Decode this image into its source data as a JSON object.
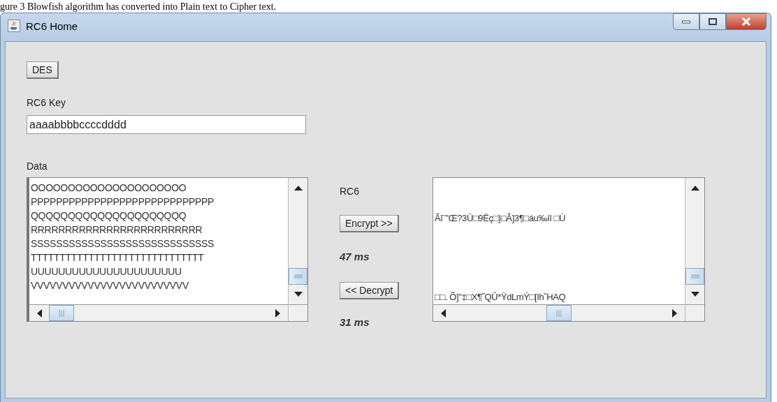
{
  "caption": "gure 3 Blowfish algorithm has converted into Plain text to Cipher text.",
  "window": {
    "title": "RC6 Home"
  },
  "des_button": "DES",
  "key": {
    "label": "RC6 Key",
    "value": "aaaabbbbccccdddd"
  },
  "data": {
    "label": "Data",
    "lines": [
      "OOOOOOOOOOOOOOOOOOOOO",
      "PPPPPPPPPPPPPPPPPPPPPPPPPPPPP",
      "QQQQQQQQQQQQQQQQQQQQQ",
      "RRRRRRRRRRRRRRRRRRRRRRRRR",
      "SSSSSSSSSSSSSSSSSSSSSSSSSSSSS",
      "TTTTTTTTTTTTTTTTTTTTTTTTTTTTTT",
      "UUUUUUUUUUUUUUUUUUUUUU",
      "VVVVVVVVVVVVVVVVVVVVVVVVV"
    ]
  },
  "algorithm": "RC6",
  "encrypt": {
    "label": "Encrypt >>",
    "time": "47 ms"
  },
  "decrypt": {
    "label": "<< Decrypt",
    "time": "31 ms"
  },
  "cipher": {
    "lines": [
      "Âî¨\"Œ?3Ü□9Ëç□}□Â]3¶□áu‰íI □Ú",
      "□□. Õ]\"‡□X¶˜QÛ*ŸdLmÝ□[Ih˜HAQ"
    ]
  }
}
